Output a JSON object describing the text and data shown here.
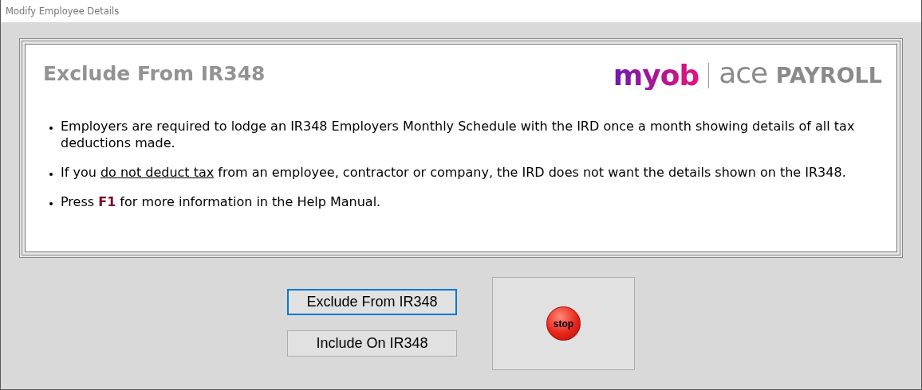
{
  "window": {
    "title": "Modify Employee Details"
  },
  "panel": {
    "heading": "Exclude From IR348",
    "logo": {
      "brand": "myob",
      "product": "ace",
      "product_suffix": "PAYROLL"
    },
    "bullets": [
      [
        {
          "kind": "plain",
          "text": "Employers are required to lodge an IR348 Employers Monthly Schedule with the IRD once a month showing details of all tax deductions made."
        }
      ],
      [
        {
          "kind": "plain",
          "text": "If you "
        },
        {
          "kind": "underline",
          "text": "do not deduct tax"
        },
        {
          "kind": "plain",
          "text": " from an employee, contractor or company, the IRD does not want the details shown on the IR348."
        }
      ],
      [
        {
          "kind": "plain",
          "text": "Press "
        },
        {
          "kind": "key",
          "text": "F1"
        },
        {
          "kind": "plain",
          "text": " for more information in the Help Manual."
        }
      ]
    ]
  },
  "buttons": [
    {
      "label": "Exclude From IR348",
      "focused": true
    },
    {
      "label": "Include On IR348",
      "focused": false
    }
  ],
  "stop_button": {
    "label": "stop"
  }
}
